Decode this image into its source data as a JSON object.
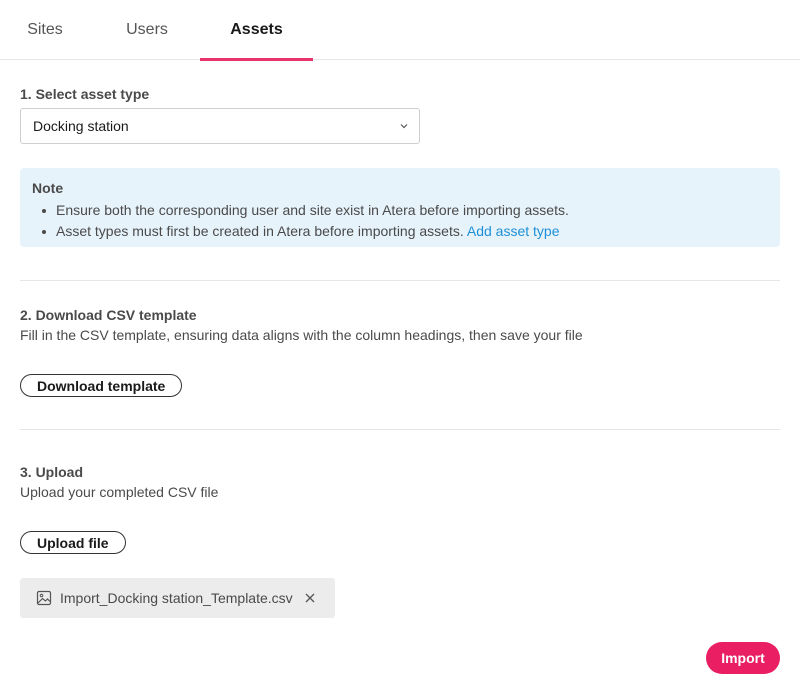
{
  "tabs": {
    "sites": "Sites",
    "users": "Users",
    "assets": "Assets",
    "active": "assets"
  },
  "step1": {
    "title": "1. Select asset type",
    "select_value": "Docking station"
  },
  "note": {
    "title": "Note",
    "items": [
      "Ensure both the corresponding user and site exist in Atera before importing assets.",
      "Asset types must first be created in Atera before importing assets."
    ],
    "link": "Add asset type"
  },
  "step2": {
    "title": "2. Download CSV template",
    "description": "Fill in the CSV template, ensuring data aligns with the column headings, then save your file",
    "button": "Download template"
  },
  "step3": {
    "title": "3. Upload",
    "description": "Upload your completed CSV file",
    "button": "Upload file",
    "file_name": "Import_Docking station_Template.csv"
  },
  "footer": {
    "import_button": "Import"
  },
  "colors": {
    "accent": "#e91e63",
    "link": "#1e8fd6",
    "note_bg": "#e7f3fb"
  },
  "icons": {
    "select_chevron": "chevron-down-icon",
    "file": "image-file-icon",
    "remove": "close-icon"
  }
}
